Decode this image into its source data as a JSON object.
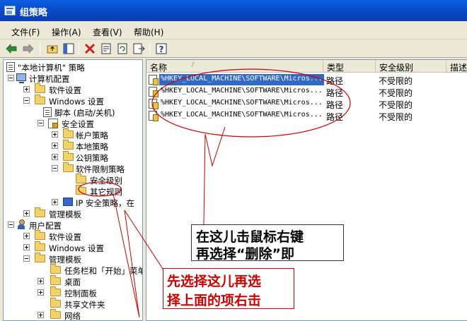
{
  "window": {
    "title": "组策略"
  },
  "menu": [
    {
      "label": "文件(F)"
    },
    {
      "label": "操作(A)"
    },
    {
      "label": "查看(V)"
    },
    {
      "label": "帮助(H)"
    }
  ],
  "tree": {
    "root": "\"本地计算机\" 策略",
    "computer_config": "计算机配置",
    "software_settings_1": "软件设置",
    "windows_settings_1": "Windows 设置",
    "scripts": "脚本 (启动/关机)",
    "security_settings": "安全设置",
    "account_policy": "帐户策略",
    "local_policy": "本地策略",
    "public_key_policy": "公钥策略",
    "software_restriction": "软件限制策略",
    "security_levels": "安全级别",
    "other_rules": "其它规则",
    "ip_security": "IP 安全策略，在",
    "admin_templates_1": "管理模板",
    "user_config": "用户配置",
    "software_settings_2": "软件设置",
    "windows_settings_2": "Windows 设置",
    "admin_templates_2": "管理模板",
    "taskbar_start": "任务栏和「开始」菜单",
    "desktop": "桌面",
    "control_panel": "控制面板",
    "shared_folders": "共享文件夹",
    "network": "网络"
  },
  "list": {
    "columns": {
      "name": "名称",
      "type": "类型",
      "security_level": "安全级别",
      "description": "描述"
    },
    "rows": [
      {
        "name": "%HKEY_LOCAL_MACHINE\\SOFTWARE\\Micros...",
        "type": "路径",
        "level": "不受限的"
      },
      {
        "name": "%HKEY_LOCAL_MACHINE\\SOFTWARE\\Micros...",
        "type": "路径",
        "level": "不受限的"
      },
      {
        "name": "%HKEY_LOCAL_MACHINE\\SOFTWARE\\Micros...",
        "type": "路径",
        "level": "不受限的"
      },
      {
        "name": "%HKEY_LOCAL_MACHINE\\SOFTWARE\\Micros...",
        "type": "路径",
        "level": "不受限的"
      }
    ]
  },
  "annotations": {
    "box1_line1": "在这儿击鼠标右键",
    "box1_line2": "再选择“删除”即",
    "box2_line1": "先选择这儿再选",
    "box2_line2": "择上面的项右击",
    "annotation_color": "#CC0000"
  },
  "colors": {
    "titlebar": "#0A5FE0",
    "selection": "#316AC5",
    "chrome": "#ECE9D8"
  }
}
